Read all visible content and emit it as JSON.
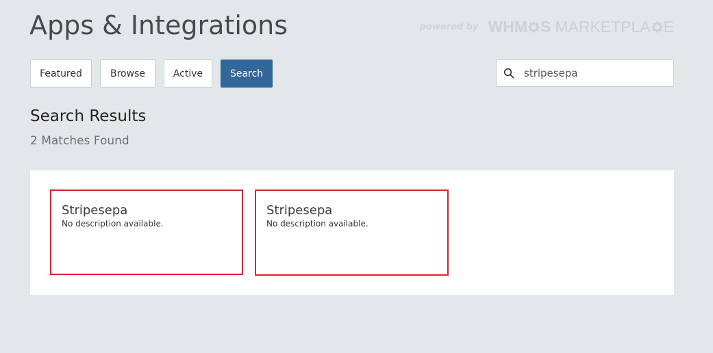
{
  "header": {
    "title": "Apps & Integrations",
    "powered_by": "powered by",
    "brand_prefix": "WHM",
    "brand_suffix": "S",
    "brand_market": "MARKETPLA",
    "brand_market_end": "E"
  },
  "tabs": [
    {
      "label": "Featured",
      "active": false
    },
    {
      "label": "Browse",
      "active": false
    },
    {
      "label": "Active",
      "active": false
    },
    {
      "label": "Search",
      "active": true
    }
  ],
  "search": {
    "value": "stripesepa",
    "placeholder": "",
    "icon": "search-icon"
  },
  "results": {
    "heading": "Search Results",
    "count_text": "2 Matches Found",
    "items": [
      {
        "title": "Stripesepa",
        "description": "No description available."
      },
      {
        "title": "Stripesepa",
        "description": "No description available."
      }
    ]
  },
  "colors": {
    "background": "#e3e7ea",
    "accent": "#336699",
    "card_border": "#d9232e"
  }
}
